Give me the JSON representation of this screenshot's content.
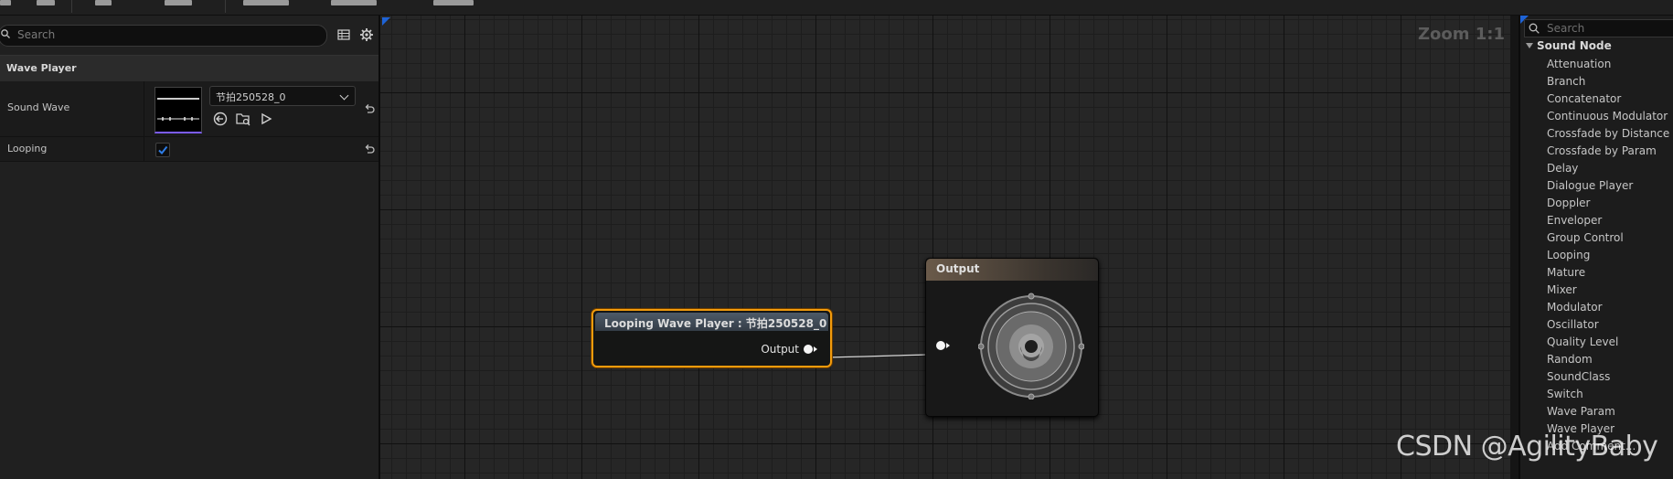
{
  "details": {
    "search_placeholder": "Search",
    "section_title": "Wave Player",
    "sound_wave": {
      "label": "Sound Wave",
      "asset": "节拍250528_0"
    },
    "looping": {
      "label": "Looping",
      "checked": true
    }
  },
  "graph": {
    "zoom": "Zoom 1:1",
    "wave_node": {
      "title": "Looping Wave Player : 节拍250528_0",
      "output_label": "Output"
    },
    "output_node": {
      "title": "Output"
    }
  },
  "palette": {
    "search_placeholder": "Search",
    "category": "Sound Node",
    "items": [
      "Attenuation",
      "Branch",
      "Concatenator",
      "Continuous Modulator",
      "Crossfade by Distance",
      "Crossfade by Param",
      "Delay",
      "Dialogue Player",
      "Doppler",
      "Enveloper",
      "Group Control",
      "Looping",
      "Mature",
      "Mixer",
      "Modulator",
      "Oscillator",
      "Quality Level",
      "Random",
      "SoundClass",
      "Switch",
      "Wave Param",
      "Wave Player",
      "Add Comment..."
    ]
  },
  "watermark": "CSDN @AgilityBaby",
  "colors": {
    "accent": "#1e63d6",
    "selection": "#f29b0c",
    "wave_underline": "#7b5cff"
  }
}
